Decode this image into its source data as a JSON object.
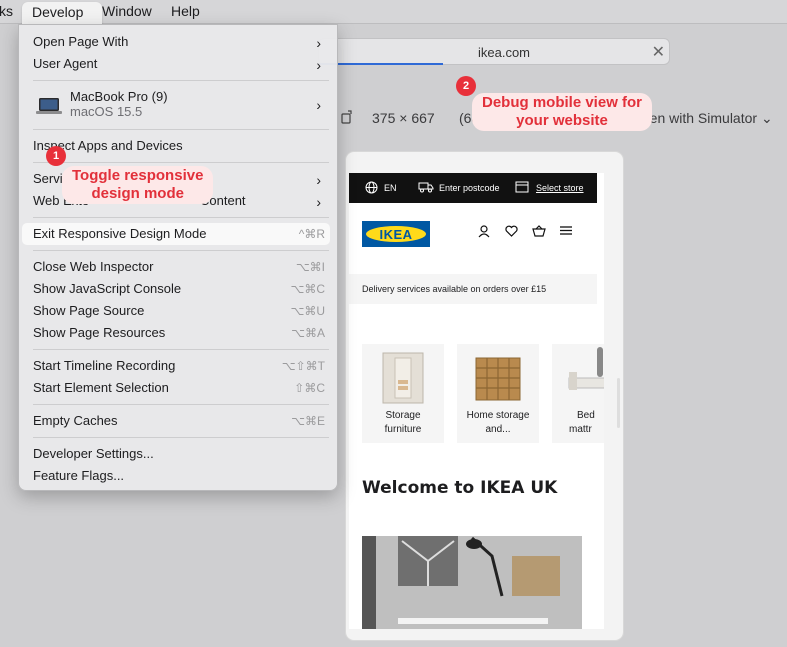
{
  "menubar": {
    "partial_left": "ks",
    "develop": "Develop",
    "window": "Window",
    "help": "Help"
  },
  "browser": {
    "url": "ikea.com",
    "close_symbol": "✕",
    "viewport_size": "375 × 667",
    "zoom": "(68%)",
    "simulator_label": "Open with Simulator",
    "simulator_chevron": "⌄"
  },
  "menu": {
    "items": [
      {
        "label": "Open Page With",
        "submenu": "›"
      },
      {
        "label": "User Agent",
        "submenu": "›"
      },
      {
        "label": "MacBook Pro (9)",
        "sublabel": "macOS 15.5",
        "submenu": "›"
      },
      {
        "label": "Inspect Apps and Devices"
      },
      {
        "label": "Servi",
        "submenu": "›"
      },
      {
        "label": "Web Exte",
        "label_suffix": "Content",
        "submenu": "›"
      },
      {
        "label": "Exit Responsive Design Mode",
        "shortcut": "^⌘R"
      },
      {
        "label": "Close Web Inspector",
        "shortcut": "⌥⌘I"
      },
      {
        "label": "Show JavaScript Console",
        "shortcut": "⌥⌘C"
      },
      {
        "label": "Show Page Source",
        "shortcut": "⌥⌘U"
      },
      {
        "label": "Show Page Resources",
        "shortcut": "⌥⌘A"
      },
      {
        "label": "Start Timeline Recording",
        "shortcut": "⌥⇧⌘T"
      },
      {
        "label": "Start Element Selection",
        "shortcut": "⇧⌘C"
      },
      {
        "label": "Empty Caches",
        "shortcut": "⌥⌘E"
      },
      {
        "label": "Developer Settings..."
      },
      {
        "label": "Feature Flags..."
      }
    ]
  },
  "callouts": {
    "one": {
      "badge": "1",
      "line1": "Toggle responsive",
      "line2": "design mode"
    },
    "two": {
      "badge": "2",
      "line1": "Debug mobile view for",
      "line2": "your website"
    }
  },
  "site": {
    "lang": "EN",
    "postcode": "Enter postcode",
    "store": "Select store",
    "logo": "IKEA",
    "delivery": "Delivery services available on orders over £15",
    "cards": [
      {
        "line1": "Storage",
        "line2": "furniture"
      },
      {
        "line1": "Home storage",
        "line2": "and..."
      },
      {
        "line1": "Bed",
        "line2": "mattr"
      }
    ],
    "welcome": "Welcome to IKEA UK"
  },
  "colors": {
    "accent_red": "#e2303a",
    "callout_bg": "#fde8e8",
    "ikea_blue": "#0058a3",
    "ikea_yellow": "#ffda1a"
  }
}
